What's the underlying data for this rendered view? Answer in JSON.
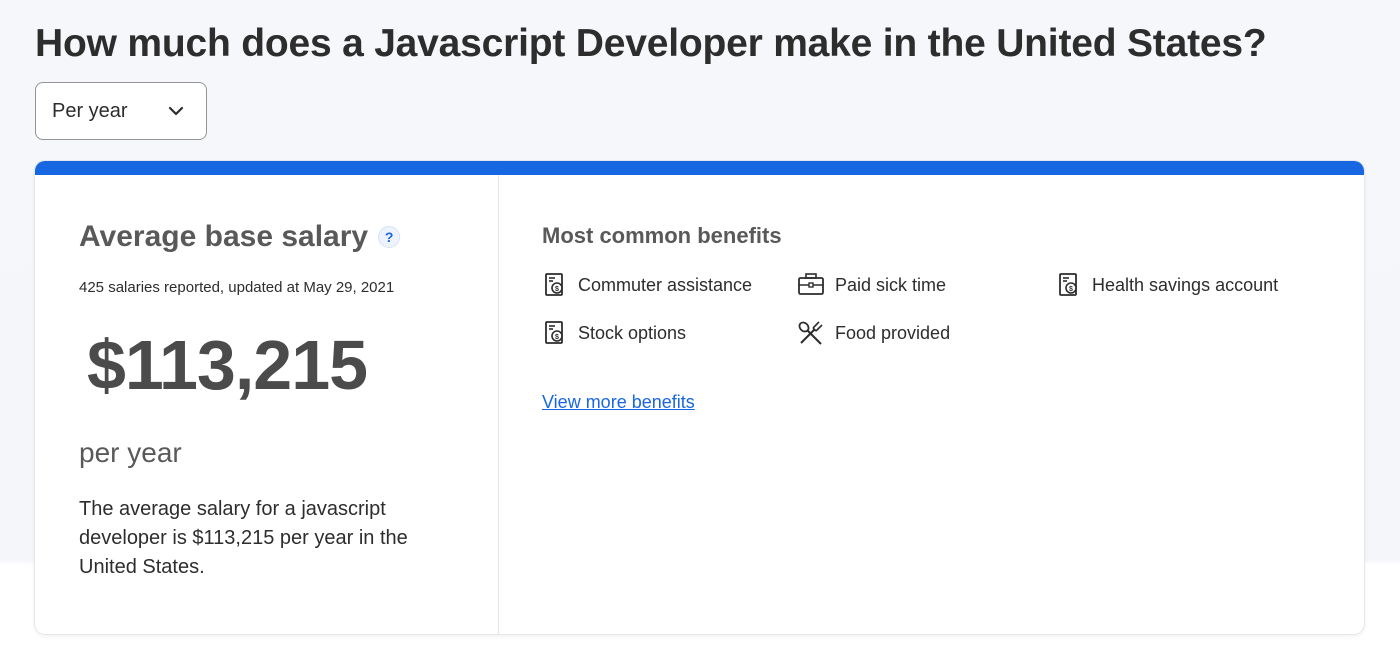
{
  "page": {
    "title": "How much does a Javascript Developer make in the United States?"
  },
  "period_select": {
    "value": "Per year"
  },
  "salary": {
    "heading": "Average base salary",
    "help_icon": "?",
    "reported": "425 salaries reported, updated at May 29, 2021",
    "amount": "$113,215",
    "period": "per year",
    "description": "The average salary for a javascript developer is $113,215 per year in the United States."
  },
  "benefits": {
    "heading": "Most common benefits",
    "items": [
      {
        "label": "Commuter assistance",
        "icon": "money-document-icon"
      },
      {
        "label": "Paid sick time",
        "icon": "briefcase-icon"
      },
      {
        "label": "Health savings account",
        "icon": "money-document-icon"
      },
      {
        "label": "Stock options",
        "icon": "money-document-icon"
      },
      {
        "label": "Food provided",
        "icon": "fork-spoon-icon"
      }
    ],
    "view_more": "View more benefits"
  },
  "colors": {
    "accent": "#1867e2",
    "heading_gray": "#595959",
    "text": "#2d2d2d"
  }
}
